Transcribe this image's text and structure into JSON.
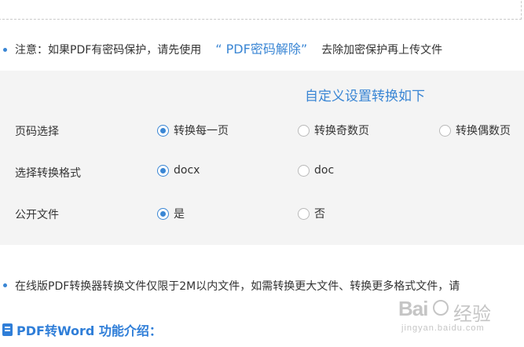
{
  "notice": {
    "prefix": "注意：如果PDF有密码保护，请先使用",
    "link": "“ PDF密码解除”",
    "suffix": "去除加密保护再上传文件"
  },
  "settings": {
    "title": "自定义设置转换如下",
    "rows": [
      {
        "label": "页码选择",
        "options": [
          {
            "label": "转换每一页",
            "checked": true
          },
          {
            "label": "转换奇数页",
            "checked": false
          },
          {
            "label": "转换偶数页",
            "checked": false
          }
        ]
      },
      {
        "label": "选择转换格式",
        "options": [
          {
            "label": "docx",
            "checked": true
          },
          {
            "label": "doc",
            "checked": false
          }
        ]
      },
      {
        "label": "公开文件",
        "options": [
          {
            "label": "是",
            "checked": true
          },
          {
            "label": "否",
            "checked": false
          }
        ]
      }
    ]
  },
  "info": {
    "text": "在线版PDF转换器转换文件仅限于2M以内文件，如需转换更大文件、转换更多格式文件，请"
  },
  "feature_section": {
    "title": "PDF转Word 功能介绍："
  },
  "watermark": {
    "brand": "Bai",
    "brand_cn": "经验",
    "url": "jingyan.baidu.com"
  },
  "colors": {
    "accent": "#3a86d4",
    "panel_bg": "#f4f4f4"
  }
}
